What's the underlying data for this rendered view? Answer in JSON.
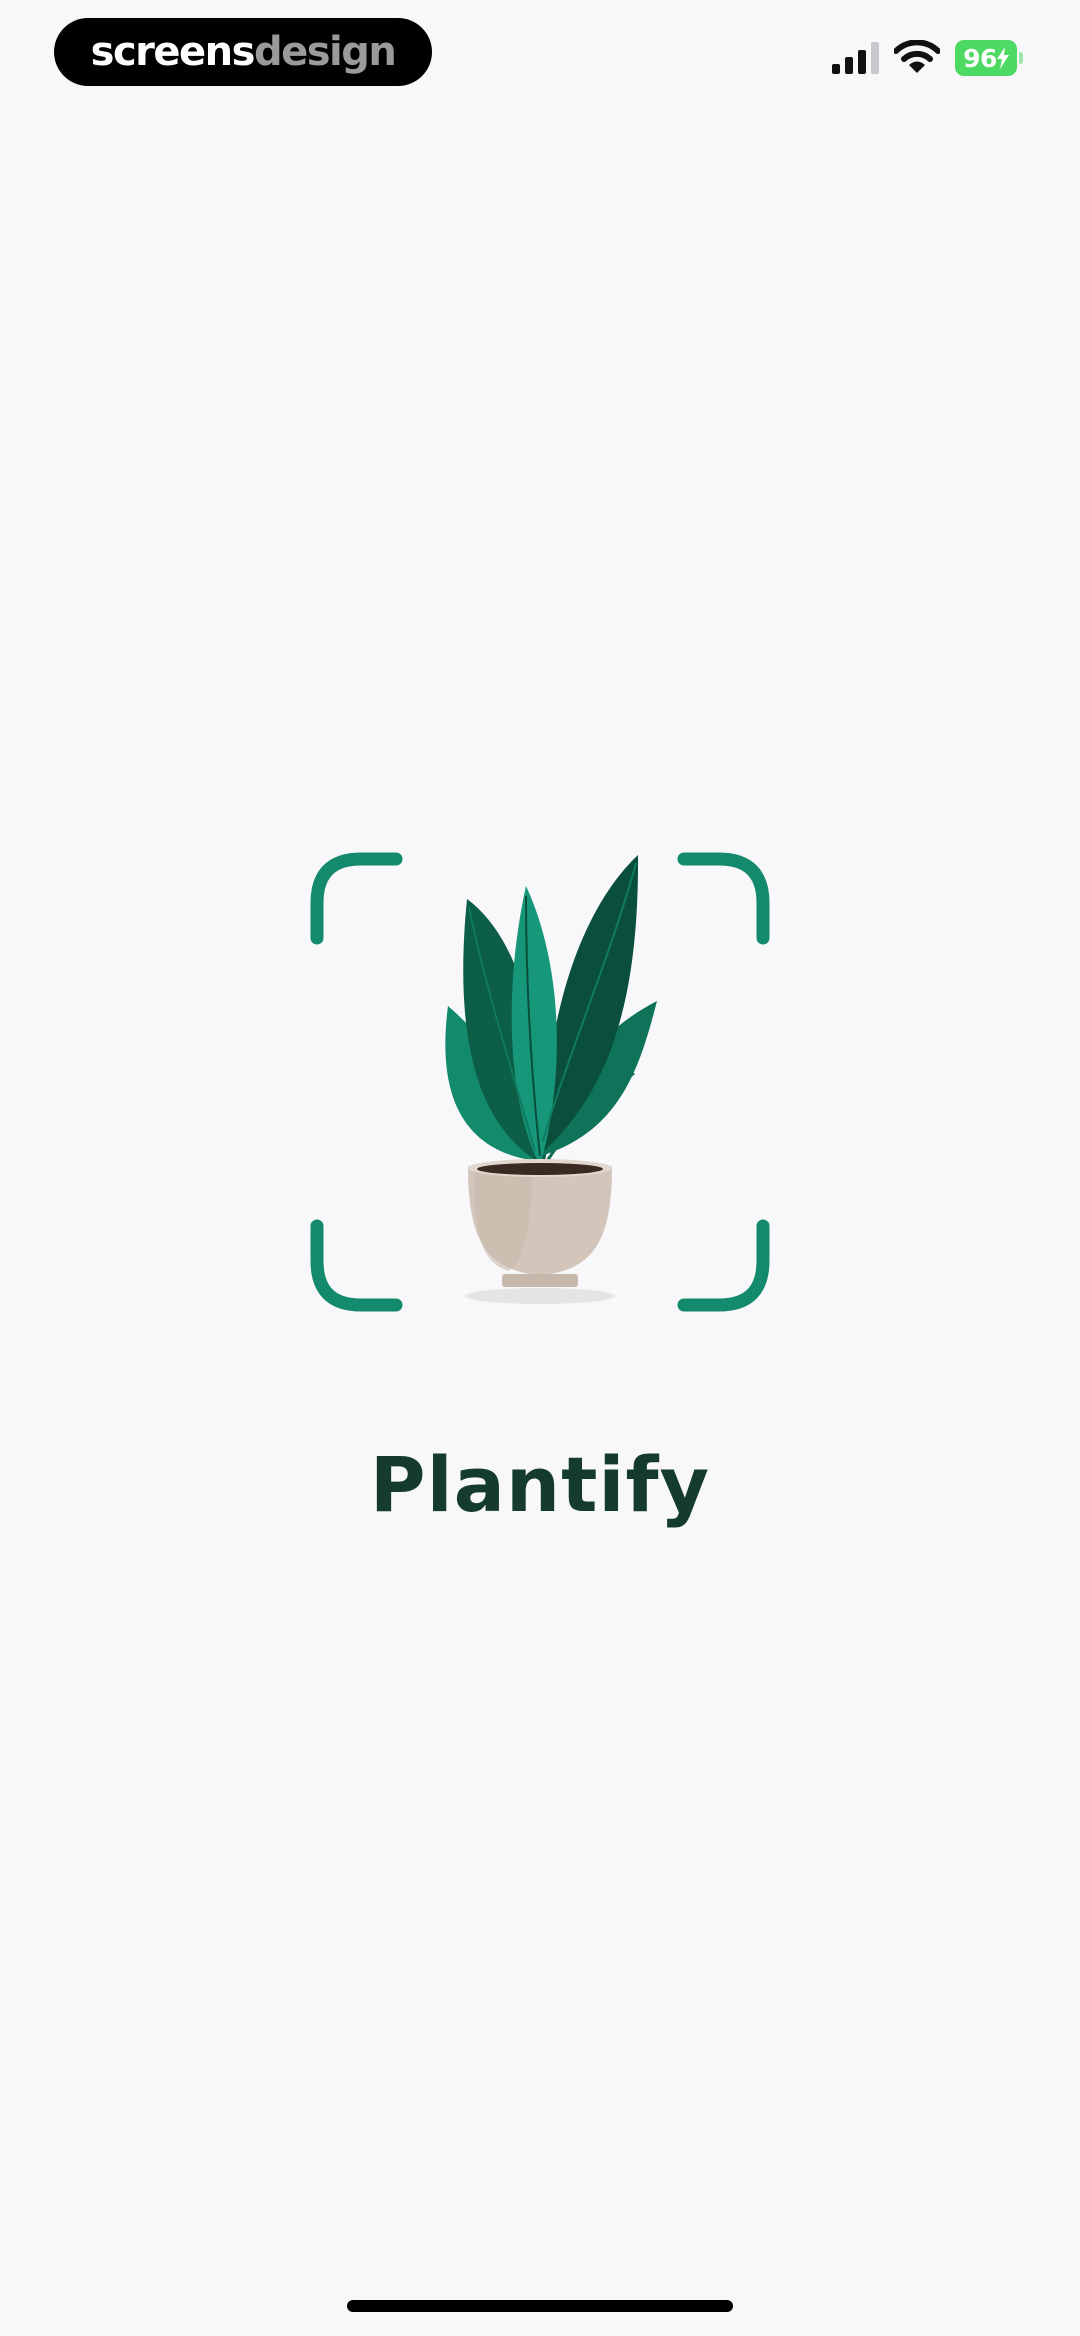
{
  "status_bar": {
    "brand_part1": "screens",
    "brand_part2": "design",
    "battery_level": "96",
    "icons": [
      "signal-icon",
      "wifi-icon",
      "battery-icon",
      "charging-bolt-icon"
    ]
  },
  "splash": {
    "app_name": "Plantify",
    "illustration_icon": "potted-plant-icon",
    "frame_icon": "scan-frame-icon"
  },
  "colors": {
    "background": "#F8F7FA",
    "accent": "#138A6B",
    "title": "#153B30",
    "battery": "#4CD964"
  }
}
